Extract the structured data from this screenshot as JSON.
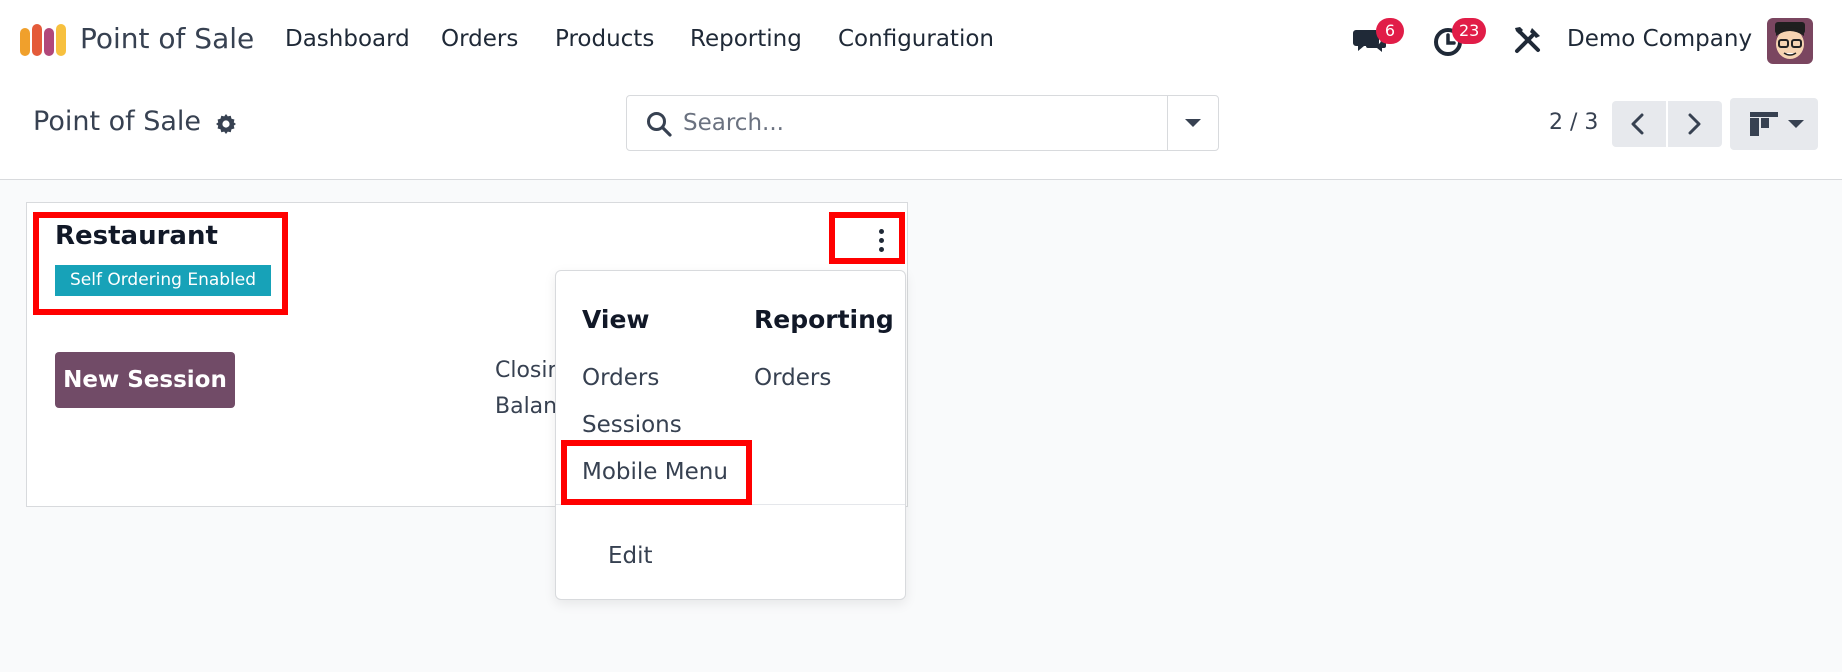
{
  "navbar": {
    "app_name": "Point of Sale",
    "menu": [
      "Dashboard",
      "Orders",
      "Products",
      "Reporting",
      "Configuration"
    ],
    "messages_count": "6",
    "activities_count": "23",
    "company": "Demo Company",
    "icons": [
      "app-logo-icon",
      "chat-icon",
      "clock-icon",
      "debug-tools-icon",
      "user-avatar"
    ]
  },
  "control_panel": {
    "title": "Point of Sale",
    "search_placeholder": "Search...",
    "pager": "2 / 3"
  },
  "card": {
    "title": "Restaurant",
    "badge": "Self Ordering Enabled",
    "new_session_label": "New Session",
    "closing_label": "Closin",
    "balance_label": "Balan"
  },
  "dropdown": {
    "view_heading": "View",
    "reporting_heading": "Reporting",
    "view_items": [
      "Orders",
      "Sessions",
      "Mobile Menu"
    ],
    "reporting_items": [
      "Orders"
    ],
    "edit_label": "Edit"
  },
  "colors": {
    "brand_purple": "#714b67",
    "badge_teal": "#17a2b8",
    "notification_red": "#e11d48",
    "annotation_red": "#ff0000"
  }
}
